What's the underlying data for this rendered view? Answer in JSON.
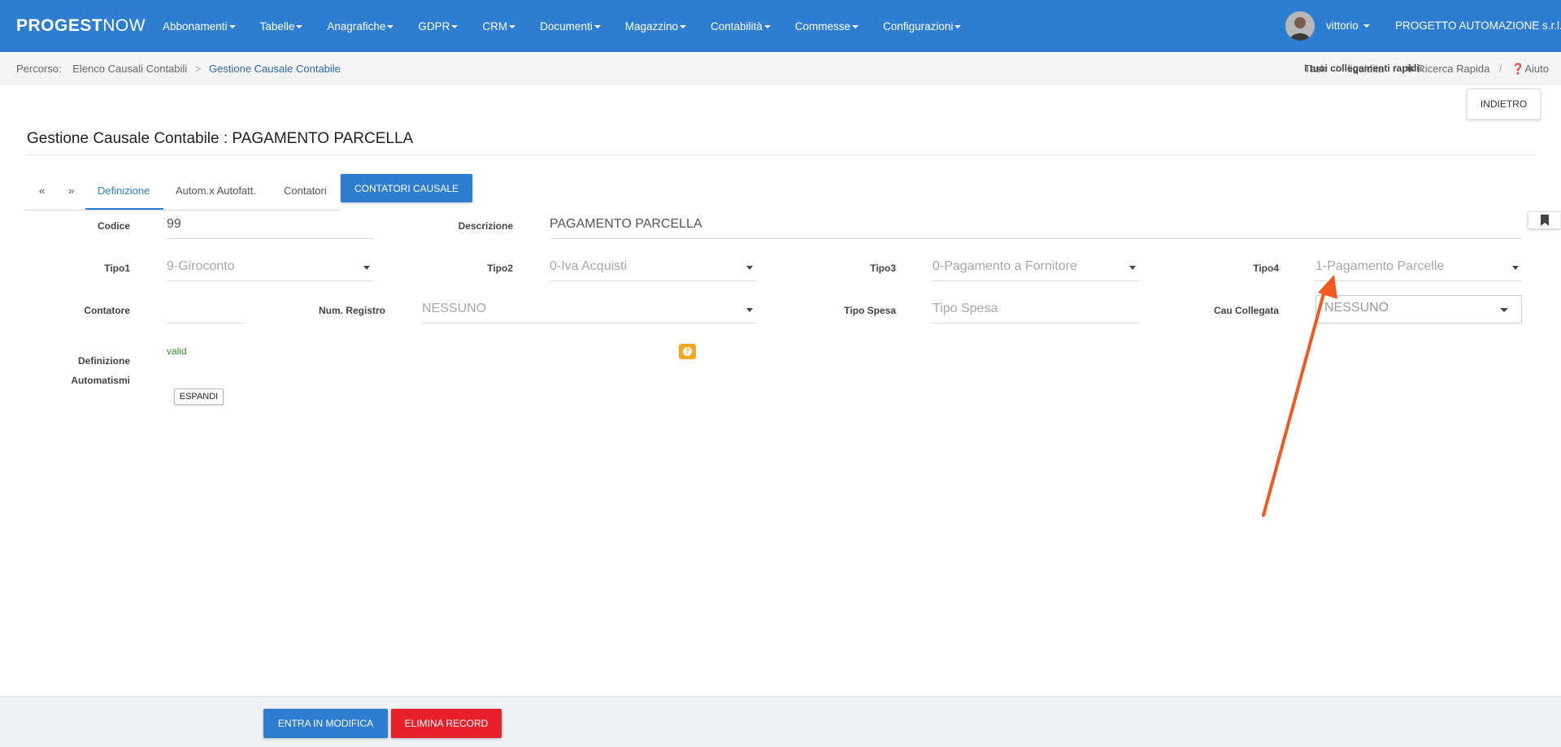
{
  "navbar": {
    "brand_bold": "PROGEST",
    "brand_light": "NOW",
    "menu": [
      "Abbonamenti",
      "Tabelle",
      "Anagrafiche",
      "GDPR",
      "CRM",
      "Documenti",
      "Magazzino",
      "Contabilità",
      "Commesse",
      "Configurazioni"
    ],
    "user": "vittorio",
    "company": "PROGETTO AUTOMAZIONE s.r.l."
  },
  "breadcrumb": {
    "label": "Percorso:",
    "items": [
      "Elenco Causali Contabili",
      "Gestione Causale Contabile"
    ]
  },
  "quick_links": {
    "label": "I tuoi collegamenti rapidi:",
    "items": [
      "Task",
      "liquidita",
      "Ricerca Rapida",
      "Aiuto"
    ]
  },
  "back_button": "INDIETRO",
  "page_title": "Gestione Causale Contabile : PAGAMENTO PARCELLA",
  "tabs": {
    "prev": "«",
    "next": "»",
    "items": [
      "Definizione",
      "Autom.x Autofatt.",
      "Contatori"
    ],
    "active": "Definizione",
    "button": "CONTATORI CAUSALE"
  },
  "form": {
    "codice": {
      "label": "Codice",
      "value": "99"
    },
    "descrizione": {
      "label": "Descrizione",
      "value": "PAGAMENTO PARCELLA"
    },
    "tipo1": {
      "label": "Tipo1",
      "value": "9-Giroconto"
    },
    "tipo2": {
      "label": "Tipo2",
      "value": "0-Iva Acquisti"
    },
    "tipo3": {
      "label": "Tipo3",
      "value": "0-Pagamento a Fornitore"
    },
    "tipo4": {
      "label": "Tipo4",
      "value": "1-Pagamento Parcelle"
    },
    "contatore": {
      "label": "Contatore",
      "value": ""
    },
    "num_registro": {
      "label": "Num. Registro",
      "value": "NESSUNO"
    },
    "tipo_spesa": {
      "label": "Tipo Spesa",
      "placeholder": "Tipo Spesa"
    },
    "cau_collegata": {
      "label": "Cau Collegata",
      "value": "NESSUNO"
    },
    "definizione_automatismi": {
      "label_line1": "Definizione",
      "label_line2": "Automatismi",
      "status": "valid",
      "expand_button": "ESPANDI"
    }
  },
  "footer": {
    "edit_button": "ENTRA IN MODIFICA",
    "delete_button": "ELIMINA RECORD"
  },
  "colors": {
    "primary": "#2d7ed0",
    "danger": "#e8202a",
    "warning": "#f5a623",
    "annotation_arrow": "#f05a1e",
    "valid": "#2e8b2e"
  }
}
